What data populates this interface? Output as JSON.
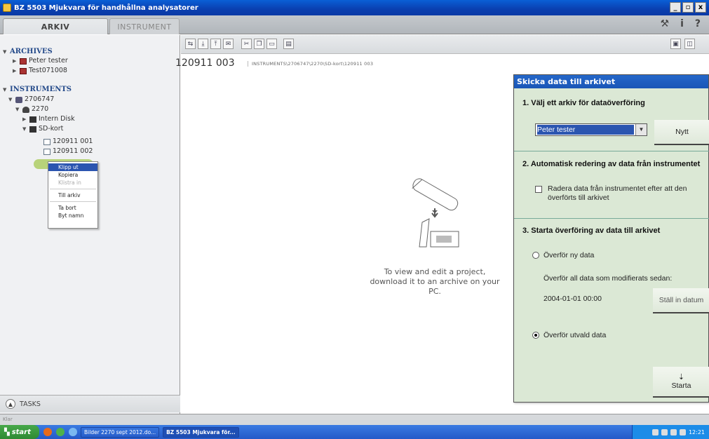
{
  "window": {
    "title": "BZ 5503 Mjukvara för handhållna analysatorer",
    "btn_min": "_",
    "btn_max": "▫",
    "btn_close": "x"
  },
  "tabs": {
    "arkiv": "ARKIV",
    "instrument": "INSTRUMENT"
  },
  "top_icons": {
    "tools": "⚒",
    "info": "i",
    "help": "?"
  },
  "sidebar": {
    "archives_title": "ARCHIVES",
    "archives": [
      "Peter tester",
      "Test071008"
    ],
    "instruments_title": "INSTRUMENTS",
    "instrument_id": "2706747",
    "user": "2270",
    "intern_disk": "Intern Disk",
    "sd_kort": "SD-kort",
    "files": [
      "120911 001",
      "120911 002"
    ],
    "tasks": "TASKS"
  },
  "context_menu": {
    "items": [
      "Klipp ut",
      "Kopiera",
      "Klistra in",
      "Till arkiv",
      "Ta bort",
      "Byt namn"
    ]
  },
  "main": {
    "project_id": "120911 003",
    "project_path": "INSTRUMENTS\\2706747\\2270\\SD-kort\\120911 003",
    "hint": "To view and edit a project, download it to an archive on your PC."
  },
  "dialog": {
    "title": "Skicka data till arkivet",
    "sec1": "1.  Välj ett arkiv för dataöverföring",
    "archive_selected": "Peter tester",
    "new_button": "Nytt",
    "sec2": "2.  Automatisk redering av data från instrumentet",
    "delete_checkbox_label": "Radera data från instrumentet efter att den överförts till arkivet",
    "sec3": "3.  Starta överföring av data till arkivet",
    "radio_new": "Överför ny data",
    "modified_since": "Överför all data som modifierats sedan:",
    "date": "2004-01-01 00:00",
    "set_date_button": "Ställ in datum",
    "radio_selected": "Överför utvald data",
    "start_button": "Starta"
  },
  "statusbar": {
    "text": "Klar"
  },
  "taskbar": {
    "start": "start",
    "tasks": [
      "Bilder 2270 sept 2012.do...",
      "BZ 5503 Mjukvara för..."
    ],
    "clock": "12:21"
  }
}
